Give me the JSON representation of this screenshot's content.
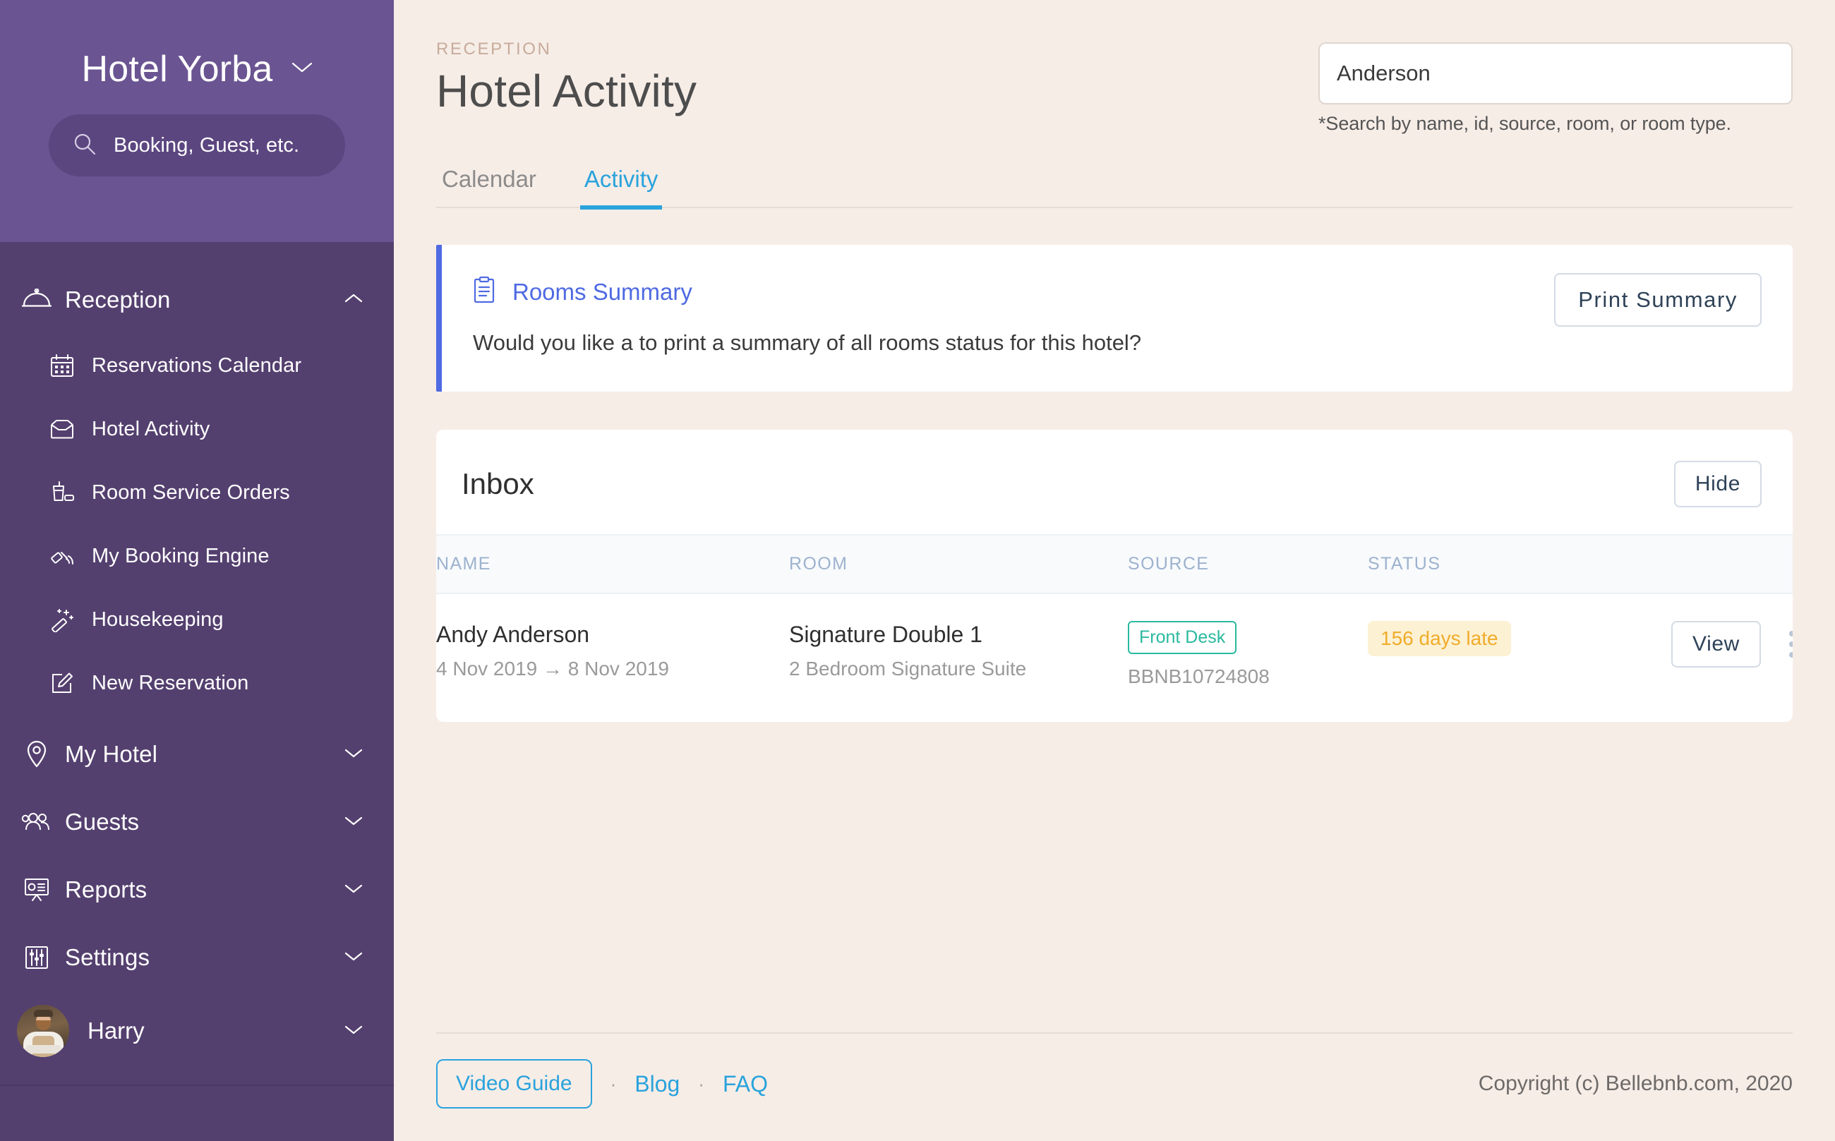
{
  "sidebar": {
    "brand": {
      "name": "Hotel Yorba",
      "caret_icon": "chevron-down-icon"
    },
    "search": {
      "placeholder": "Booking, Guest, etc.",
      "icon": "search-icon"
    },
    "groups": [
      {
        "label": "Reception",
        "icon": "service-bell-icon",
        "caret_icon": "chevron-up-icon",
        "expanded": true,
        "items": [
          {
            "label": "Reservations Calendar",
            "icon": "calendar-icon"
          },
          {
            "label": "Hotel Activity",
            "icon": "inbox-tray-icon"
          },
          {
            "label": "Room Service Orders",
            "icon": "room-service-icon"
          },
          {
            "label": "My Booking Engine",
            "icon": "booking-engine-icon"
          },
          {
            "label": "Housekeeping",
            "icon": "magic-wand-icon"
          },
          {
            "label": "New Reservation",
            "icon": "edit-document-icon"
          }
        ]
      },
      {
        "label": "My Hotel",
        "icon": "map-pin-icon",
        "caret_icon": "chevron-down-icon",
        "expanded": false,
        "items": []
      },
      {
        "label": "Guests",
        "icon": "people-icon",
        "caret_icon": "chevron-down-icon",
        "expanded": false,
        "items": []
      },
      {
        "label": "Reports",
        "icon": "presentation-chart-icon",
        "caret_icon": "chevron-down-icon",
        "expanded": false,
        "items": []
      },
      {
        "label": "Settings",
        "icon": "sliders-icon",
        "caret_icon": "chevron-down-icon",
        "expanded": false,
        "items": []
      }
    ],
    "user": {
      "name": "Harry",
      "avatar_icon": "user-avatar",
      "caret_icon": "chevron-down-icon"
    }
  },
  "header": {
    "eyebrow": "RECEPTION",
    "title": "Hotel Activity",
    "search": {
      "value": "Anderson",
      "placeholder": "Search",
      "hint": "*Search by name, id, source, room, or room type."
    }
  },
  "tabs": [
    {
      "label": "Calendar",
      "active": false
    },
    {
      "label": "Activity",
      "active": true
    }
  ],
  "summary_card": {
    "icon": "clipboard-icon",
    "title": "Rooms Summary",
    "text": "Would you like a to print a summary of all rooms status for this hotel?",
    "print_label": "Print Summary",
    "accent_color": "#4f6ae2"
  },
  "inbox": {
    "title": "Inbox",
    "hide_label": "Hide",
    "columns": [
      "NAME",
      "ROOM",
      "SOURCE",
      "STATUS",
      ""
    ],
    "rows": [
      {
        "name": "Andy Anderson",
        "dates": "4 Nov 2019 → 8 Nov 2019",
        "room": "Signature Double 1",
        "room_type": "2 Bedroom Signature Suite",
        "source": "Front Desk",
        "source_id": "BBNB10724808",
        "status": "156 days late",
        "view_label": "View",
        "menu_icon": "kebab-menu-icon"
      }
    ]
  },
  "footer": {
    "video_guide_label": "Video Guide",
    "separator": "·",
    "blog_label": "Blog",
    "faq_label": "FAQ",
    "copyright": "Copyright (c) Bellebnb.com, 2020"
  },
  "colors": {
    "sidebar_top": "#6a5491",
    "sidebar_nav": "#54406f",
    "page_bg": "#f7ede7",
    "accent_blue": "#29a3dc",
    "indigo": "#4f6ae2",
    "teal": "#2bb9a0",
    "amber": "#f0ac2b"
  }
}
